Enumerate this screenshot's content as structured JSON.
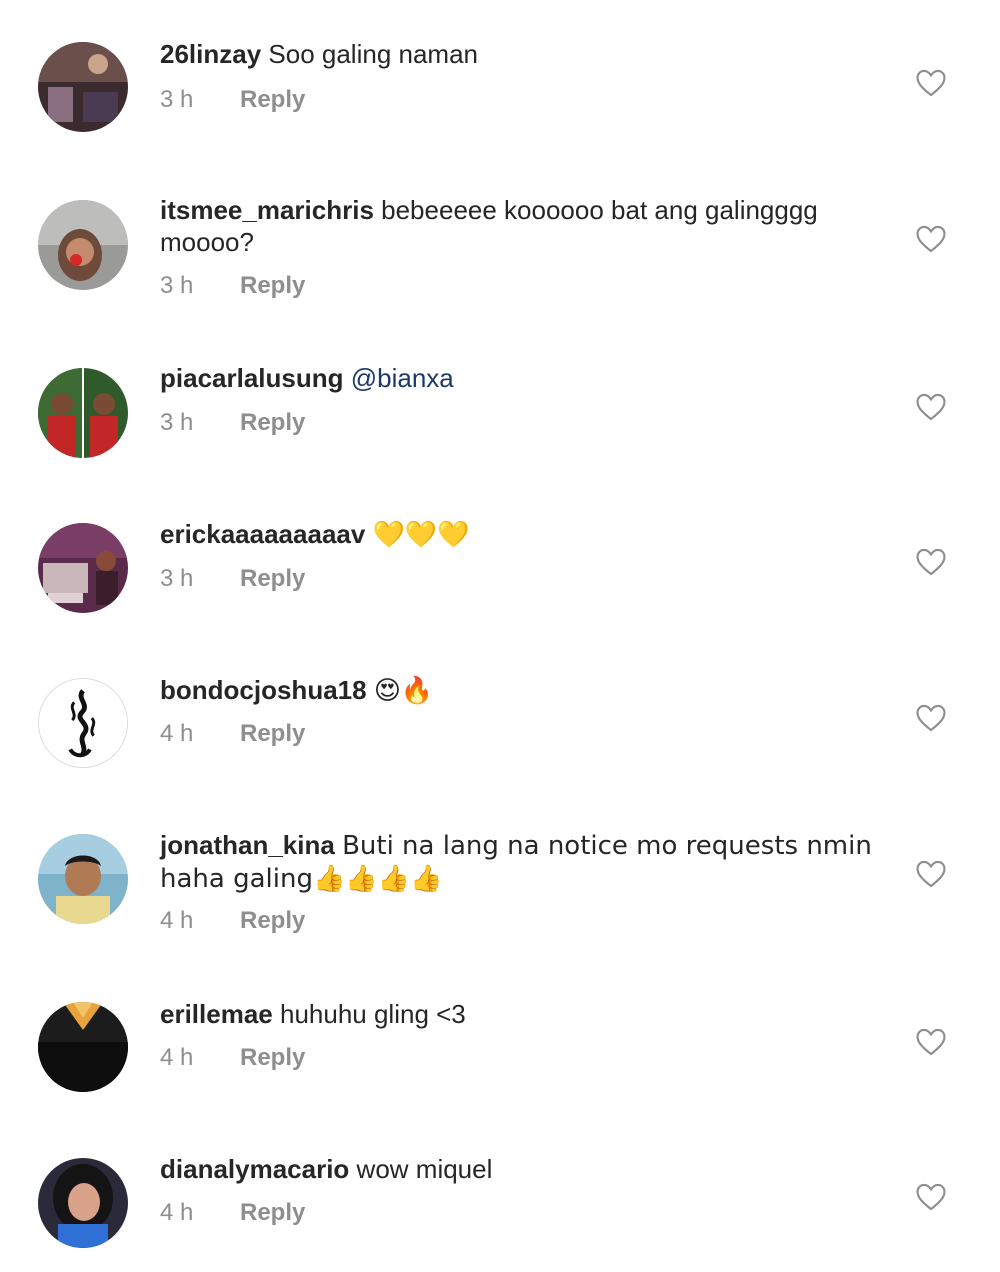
{
  "comments": [
    {
      "username": "26linzay",
      "text": "Soo galing naman",
      "time": "3 h",
      "reply": "Reply"
    },
    {
      "username": "itsmee_marichris",
      "text": "bebeeeee koooooo bat ang galingggg moooo?",
      "time": "3 h",
      "reply": "Reply"
    },
    {
      "username": "piacarlalusung",
      "text": "",
      "mention": "@bianxa",
      "time": "3 h",
      "reply": "Reply"
    },
    {
      "username": "erickaaaaaaaaav",
      "text": "💛💛💛",
      "time": "3 h",
      "reply": "Reply"
    },
    {
      "username": "bondocjoshua18",
      "text": "😍🔥",
      "time": "4 h",
      "reply": "Reply"
    },
    {
      "username": "jonathan_kina",
      "text": "Buti na lang na notice mo requests nmin haha galing👍👍👍👍",
      "time": "4 h",
      "reply": "Reply"
    },
    {
      "username": "erillemae",
      "text": "huhuhu gling <3",
      "time": "4 h",
      "reply": "Reply"
    },
    {
      "username": "dianalymacario",
      "text": "wow miquel",
      "time": "4 h",
      "reply": "Reply"
    }
  ],
  "icons": {
    "like": "heart-outline-icon"
  },
  "colors": {
    "username": "#262626",
    "meta": "#8e8e8e",
    "mention": "#1b3a6b",
    "heart_stroke": "#8e8e8e"
  }
}
